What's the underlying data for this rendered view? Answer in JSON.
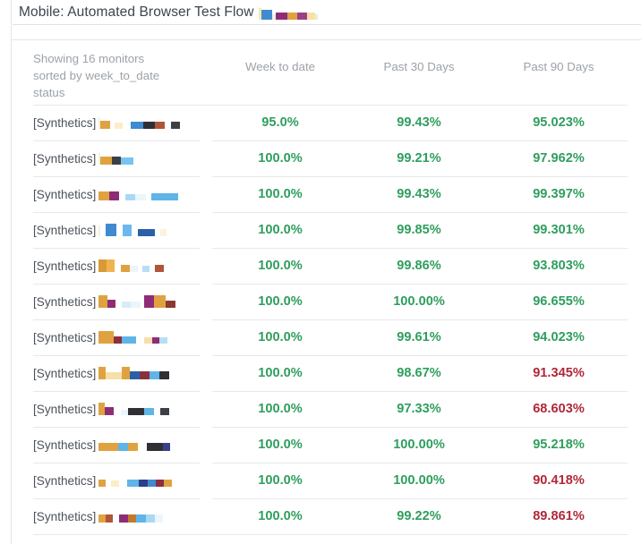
{
  "window": {
    "title": "Mobile: Automated Browser Test Flow",
    "title_redacted_blocks": [
      {
        "w": 3,
        "h": 13,
        "color": "#f7e6b4"
      },
      {
        "w": 12,
        "h": 11,
        "color": "#3f8ad1"
      },
      {
        "w": 4,
        "h": 6,
        "color": "#f2efe6"
      },
      {
        "w": 13,
        "h": 8,
        "color": "#8e2d75"
      },
      {
        "w": 11,
        "h": 8,
        "color": "#e0a240"
      },
      {
        "w": 11,
        "h": 8,
        "color": "#9b3f86"
      },
      {
        "w": 9,
        "h": 8,
        "color": "#f6e2a4"
      },
      {
        "w": 3,
        "h": 6,
        "color": "#efe9d8"
      }
    ]
  },
  "summary": {
    "line1": "Showing 16 monitors",
    "line2": "sorted by week_to_date",
    "line3": "status"
  },
  "columns": {
    "name": "",
    "week_to_date": "Week to date",
    "past_30_days": "Past 30 Days",
    "past_90_days": "Past 90 Days"
  },
  "colors": {
    "good": "#2f9e5e",
    "bad": "#b0283a",
    "header_text": "#9ca2a8",
    "title_text": "#3d4450",
    "divider": "#e6e8ea"
  },
  "rows": [
    {
      "name_prefix": "[Synthetics]",
      "redaction": [
        {
          "w": 2,
          "h": 13,
          "color": "#f3efe2"
        },
        {
          "w": 11,
          "h": 9,
          "color": "#e0a240"
        },
        {
          "w": 5,
          "h": 6,
          "color": "#ffffff"
        },
        {
          "w": 9,
          "h": 7,
          "color": "#faeec6"
        },
        {
          "w": 9,
          "h": 6,
          "color": "#ffffff"
        },
        {
          "w": 14,
          "h": 8,
          "color": "#3f8ad1"
        },
        {
          "w": 13,
          "h": 8,
          "color": "#2e3033"
        },
        {
          "w": 11,
          "h": 8,
          "color": "#b0553a"
        },
        {
          "w": 7,
          "h": 6,
          "color": "#ffffff"
        },
        {
          "w": 10,
          "h": 8,
          "color": "#3c4044"
        }
      ],
      "week_to_date": "95.0%",
      "week_to_date_state": "good",
      "past_30_days": "99.43%",
      "past_30_days_state": "good",
      "past_90_days": "95.023%",
      "past_90_days_state": "good"
    },
    {
      "name_prefix": "[Synthetics]",
      "redaction": [
        {
          "w": 2,
          "h": 13,
          "color": "#f3efe2"
        },
        {
          "w": 13,
          "h": 9,
          "color": "#e0a240"
        },
        {
          "w": 10,
          "h": 9,
          "color": "#3c4044"
        },
        {
          "w": 14,
          "h": 8,
          "color": "#76c4ef"
        }
      ],
      "week_to_date": "100.0%",
      "week_to_date_state": "good",
      "past_30_days": "99.21%",
      "past_30_days_state": "good",
      "past_90_days": "97.962%",
      "past_90_days_state": "good"
    },
    {
      "name_prefix": "[Synthetics]",
      "redaction": [
        {
          "w": 12,
          "h": 10,
          "color": "#e0a240"
        },
        {
          "w": 11,
          "h": 10,
          "color": "#8e2d75"
        },
        {
          "w": 7,
          "h": 6,
          "color": "#ffffff"
        },
        {
          "w": 11,
          "h": 7,
          "color": "#a9d8f3"
        },
        {
          "w": 12,
          "h": 7,
          "color": "#eaf6fc"
        },
        {
          "w": 6,
          "h": 6,
          "color": "#ffffff"
        },
        {
          "w": 30,
          "h": 8,
          "color": "#5fb4e8"
        }
      ],
      "week_to_date": "100.0%",
      "week_to_date_state": "good",
      "past_30_days": "99.43%",
      "past_30_days_state": "good",
      "past_90_days": "99.397%",
      "past_90_days_state": "good"
    },
    {
      "name_prefix": "[Synthetics]",
      "redaction": [
        {
          "w": 2,
          "h": 12,
          "color": "#f6efd9"
        },
        {
          "w": 6,
          "h": 6,
          "color": "#ffffff"
        },
        {
          "w": 12,
          "h": 14,
          "color": "#3f8ad1"
        },
        {
          "w": 7,
          "h": 6,
          "color": "#ffffff"
        },
        {
          "w": 10,
          "h": 13,
          "color": "#6cb8ec"
        },
        {
          "w": 7,
          "h": 6,
          "color": "#ffffff"
        },
        {
          "w": 19,
          "h": 8,
          "color": "#2b5fa8"
        },
        {
          "w": 6,
          "h": 6,
          "color": "#ffffff"
        },
        {
          "w": 7,
          "h": 8,
          "color": "#faf3dd"
        }
      ],
      "week_to_date": "100.0%",
      "week_to_date_state": "good",
      "past_30_days": "99.85%",
      "past_30_days_state": "good",
      "past_90_days": "99.301%",
      "past_90_days_state": "good"
    },
    {
      "name_prefix": "[Synthetics]",
      "redaction": [
        {
          "w": 9,
          "h": 14,
          "color": "#d99a35"
        },
        {
          "w": 9,
          "h": 14,
          "color": "#f0b351"
        },
        {
          "w": 7,
          "h": 6,
          "color": "#ffffff"
        },
        {
          "w": 10,
          "h": 8,
          "color": "#e0a240"
        },
        {
          "w": 9,
          "h": 7,
          "color": "#eaf6fc"
        },
        {
          "w": 5,
          "h": 6,
          "color": "#ffffff"
        },
        {
          "w": 8,
          "h": 7,
          "color": "#b6dff5"
        },
        {
          "w": 6,
          "h": 6,
          "color": "#ffffff"
        },
        {
          "w": 10,
          "h": 8,
          "color": "#b0553a"
        }
      ],
      "week_to_date": "100.0%",
      "week_to_date_state": "good",
      "past_30_days": "99.86%",
      "past_30_days_state": "good",
      "past_90_days": "93.803%",
      "past_90_days_state": "good"
    },
    {
      "name_prefix": "[Synthetics]",
      "redaction": [
        {
          "w": 10,
          "h": 14,
          "color": "#e0a240"
        },
        {
          "w": 9,
          "h": 9,
          "color": "#8e2d75"
        },
        {
          "w": 7,
          "h": 6,
          "color": "#ffffff"
        },
        {
          "w": 10,
          "h": 7,
          "color": "#d6ecf8"
        },
        {
          "w": 11,
          "h": 7,
          "color": "#eaf6fc"
        },
        {
          "w": 4,
          "h": 6,
          "color": "#ffffff"
        },
        {
          "w": 11,
          "h": 14,
          "color": "#8e2d75"
        },
        {
          "w": 13,
          "h": 14,
          "color": "#e0a240"
        },
        {
          "w": 11,
          "h": 8,
          "color": "#8a3a2e"
        }
      ],
      "week_to_date": "100.0%",
      "week_to_date_state": "good",
      "past_30_days": "100.00%",
      "past_30_days_state": "good",
      "past_90_days": "96.655%",
      "past_90_days_state": "good"
    },
    {
      "name_prefix": "[Synthetics]",
      "redaction": [
        {
          "w": 17,
          "h": 14,
          "color": "#e0a240"
        },
        {
          "w": 9,
          "h": 8,
          "color": "#8a2f3e"
        },
        {
          "w": 16,
          "h": 8,
          "color": "#5fb4e8"
        },
        {
          "w": 9,
          "h": 6,
          "color": "#ffffff"
        },
        {
          "w": 9,
          "h": 7,
          "color": "#f6dfa8"
        },
        {
          "w": 8,
          "h": 7,
          "color": "#8e2d75"
        },
        {
          "w": 9,
          "h": 7,
          "color": "#b6dff5"
        }
      ],
      "week_to_date": "100.0%",
      "week_to_date_state": "good",
      "past_30_days": "99.61%",
      "past_30_days_state": "good",
      "past_90_days": "94.023%",
      "past_90_days_state": "good"
    },
    {
      "name_prefix": "[Synthetics]",
      "redaction": [
        {
          "w": 8,
          "h": 14,
          "color": "#e0a240"
        },
        {
          "w": 18,
          "h": 8,
          "color": "#f6dfa8"
        },
        {
          "w": 9,
          "h": 14,
          "color": "#e0a240"
        },
        {
          "w": 11,
          "h": 9,
          "color": "#2b5fa8"
        },
        {
          "w": 11,
          "h": 9,
          "color": "#8a2f3e"
        },
        {
          "w": 11,
          "h": 9,
          "color": "#5fb4e8"
        },
        {
          "w": 11,
          "h": 9,
          "color": "#2e3033"
        }
      ],
      "week_to_date": "100.0%",
      "week_to_date_state": "good",
      "past_30_days": "98.67%",
      "past_30_days_state": "good",
      "past_90_days": "91.345%",
      "past_90_days_state": "bad"
    },
    {
      "name_prefix": "[Synthetics]",
      "redaction": [
        {
          "w": 7,
          "h": 14,
          "color": "#e0a240"
        },
        {
          "w": 10,
          "h": 9,
          "color": "#8e2d75"
        },
        {
          "w": 8,
          "h": 6,
          "color": "#ffffff"
        },
        {
          "w": 8,
          "h": 6,
          "color": "#eaf6fc"
        },
        {
          "w": 18,
          "h": 8,
          "color": "#2e3033"
        },
        {
          "w": 11,
          "h": 8,
          "color": "#5fb4e8"
        },
        {
          "w": 7,
          "h": 6,
          "color": "#ffffff"
        },
        {
          "w": 10,
          "h": 8,
          "color": "#3c4044"
        }
      ],
      "week_to_date": "100.0%",
      "week_to_date_state": "good",
      "past_30_days": "97.33%",
      "past_30_days_state": "good",
      "past_90_days": "68.603%",
      "past_90_days_state": "bad"
    },
    {
      "name_prefix": "[Synthetics]",
      "redaction": [
        {
          "w": 22,
          "h": 9,
          "color": "#e0a240"
        },
        {
          "w": 11,
          "h": 9,
          "color": "#5fb4e8"
        },
        {
          "w": 11,
          "h": 9,
          "color": "#e0a240"
        },
        {
          "w": 10,
          "h": 6,
          "color": "#ffffff"
        },
        {
          "w": 18,
          "h": 9,
          "color": "#2e3033"
        },
        {
          "w": 8,
          "h": 9,
          "color": "#3a3f8a"
        }
      ],
      "week_to_date": "100.0%",
      "week_to_date_state": "good",
      "past_30_days": "100.00%",
      "past_30_days_state": "good",
      "past_90_days": "95.218%",
      "past_90_days_state": "good"
    },
    {
      "name_prefix": "[Synthetics]",
      "redaction": [
        {
          "w": 8,
          "h": 8,
          "color": "#e0a240"
        },
        {
          "w": 6,
          "h": 6,
          "color": "#ffffff"
        },
        {
          "w": 9,
          "h": 7,
          "color": "#faeec6"
        },
        {
          "w": 9,
          "h": 6,
          "color": "#ffffff"
        },
        {
          "w": 13,
          "h": 8,
          "color": "#5fb4e8"
        },
        {
          "w": 10,
          "h": 8,
          "color": "#2b3f8a"
        },
        {
          "w": 9,
          "h": 8,
          "color": "#3f8ad1"
        },
        {
          "w": 9,
          "h": 8,
          "color": "#8a2f3e"
        },
        {
          "w": 9,
          "h": 8,
          "color": "#e0a240"
        }
      ],
      "week_to_date": "100.0%",
      "week_to_date_state": "good",
      "past_30_days": "100.00%",
      "past_30_days_state": "good",
      "past_90_days": "90.418%",
      "past_90_days_state": "bad"
    },
    {
      "name_prefix": "[Synthetics]",
      "redaction": [
        {
          "w": 8,
          "h": 9,
          "color": "#e0a240"
        },
        {
          "w": 8,
          "h": 9,
          "color": "#b0553a"
        },
        {
          "w": 7,
          "h": 6,
          "color": "#ffffff"
        },
        {
          "w": 10,
          "h": 9,
          "color": "#8e2d75"
        },
        {
          "w": 9,
          "h": 9,
          "color": "#c07a2e"
        },
        {
          "w": 11,
          "h": 9,
          "color": "#5fb4e8"
        },
        {
          "w": 10,
          "h": 9,
          "color": "#a9d8f3"
        },
        {
          "w": 9,
          "h": 9,
          "color": "#eaf6fc"
        }
      ],
      "week_to_date": "100.0%",
      "week_to_date_state": "good",
      "past_30_days": "99.22%",
      "past_30_days_state": "good",
      "past_90_days": "89.861%",
      "past_90_days_state": "bad"
    }
  ]
}
